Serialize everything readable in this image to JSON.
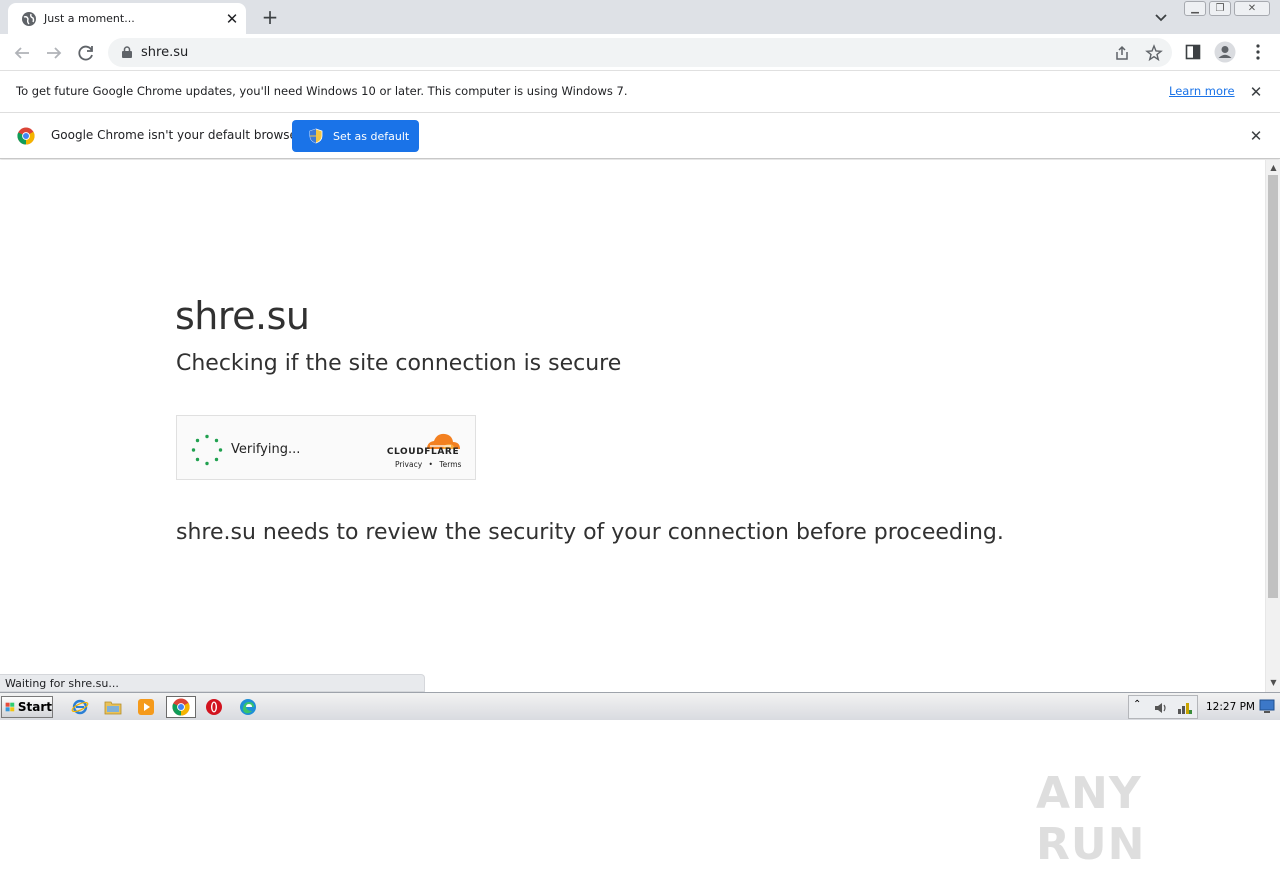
{
  "browser": {
    "tab_title": "Just a moment...",
    "url": "shre.su"
  },
  "infobars": {
    "update_message": "To get future Google Chrome updates, you'll need Windows 10 or later. This computer is using Windows 7.",
    "learn_more": "Learn more",
    "default_message": "Google Chrome isn't your default browser",
    "set_default_label": "Set as default"
  },
  "page": {
    "site_name": "shre.su",
    "subtitle": "Checking if the site connection is secure",
    "verifying": "Verifying...",
    "cloudflare_brand": "CLOUDFLARE",
    "privacy": "Privacy",
    "separator": "•",
    "terms": "Terms",
    "review_message": "shre.su needs to review the security of your connection before proceeding."
  },
  "status": {
    "text": "Waiting for shre.su..."
  },
  "watermark": "ANY RUN",
  "taskbar": {
    "start_label": "Start",
    "clock": "12:27 PM"
  },
  "colors": {
    "accent": "#1a73e8",
    "cloudflare_orange": "#f38020",
    "spinner_green": "#21a150"
  }
}
